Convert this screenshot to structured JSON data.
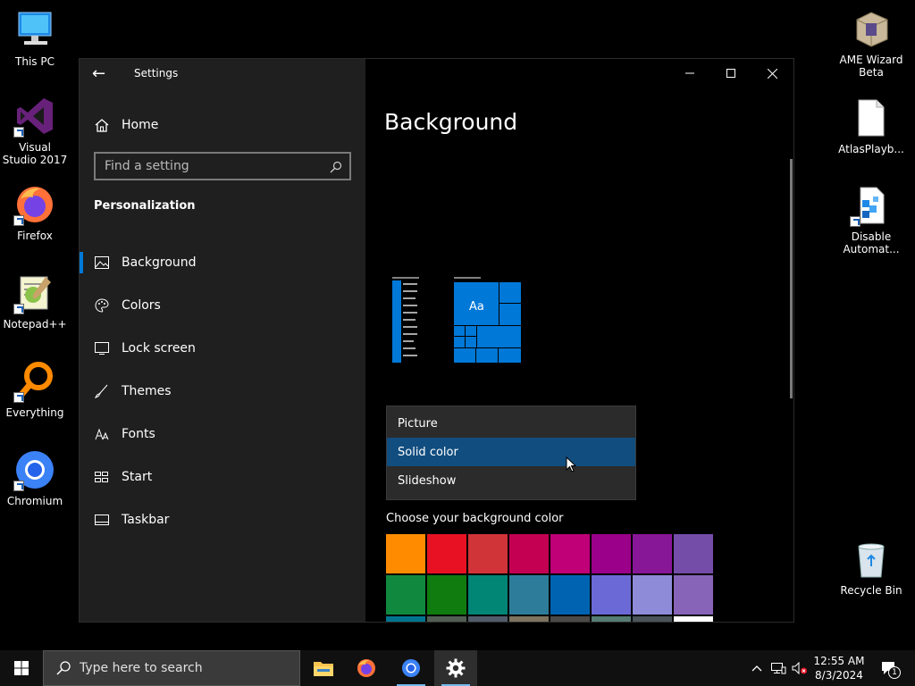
{
  "desktop": {
    "icons_left": [
      {
        "label": "This PC"
      },
      {
        "label": "Visual Studio 2017"
      },
      {
        "label": "Firefox"
      },
      {
        "label": "Notepad++"
      },
      {
        "label": "Everything"
      },
      {
        "label": "Chromium"
      }
    ],
    "icons_right": [
      {
        "label": "AME Wizard Beta"
      },
      {
        "label": "AtlasPlayb..."
      },
      {
        "label": "Disable Automat..."
      },
      {
        "label": "Recycle Bin"
      }
    ]
  },
  "settings": {
    "app_title": "Settings",
    "home_label": "Home",
    "search_placeholder": "Find a setting",
    "section_title": "Personalization",
    "nav_items": [
      {
        "label": "Background",
        "icon": "picture-icon",
        "active": true
      },
      {
        "label": "Colors",
        "icon": "palette-icon",
        "active": false
      },
      {
        "label": "Lock screen",
        "icon": "lock-screen-icon",
        "active": false
      },
      {
        "label": "Themes",
        "icon": "brush-icon",
        "active": false
      },
      {
        "label": "Fonts",
        "icon": "fonts-icon",
        "active": false
      },
      {
        "label": "Start",
        "icon": "start-grid-icon",
        "active": false
      },
      {
        "label": "Taskbar",
        "icon": "taskbar-icon",
        "active": false
      }
    ],
    "page_title": "Background",
    "preview_tile_text": "Aa",
    "dropdown_options": [
      "Picture",
      "Solid color",
      "Slideshow"
    ],
    "dropdown_selected": "Solid color",
    "choose_color_label": "Choose your background color",
    "swatch_colors": [
      "#ff8c00",
      "#e81123",
      "#d13438",
      "#c30052",
      "#bf0077",
      "#9a0089",
      "#881798",
      "#744da9",
      "#10893e",
      "#107c10",
      "#018574",
      "#2d7d9a",
      "#0063b1",
      "#6b69d6",
      "#8e8cd8",
      "#8764b8"
    ]
  },
  "taskbar": {
    "search_placeholder": "Type here to search",
    "time": "12:55 AM",
    "date": "8/3/2024",
    "notification_count": "1"
  }
}
